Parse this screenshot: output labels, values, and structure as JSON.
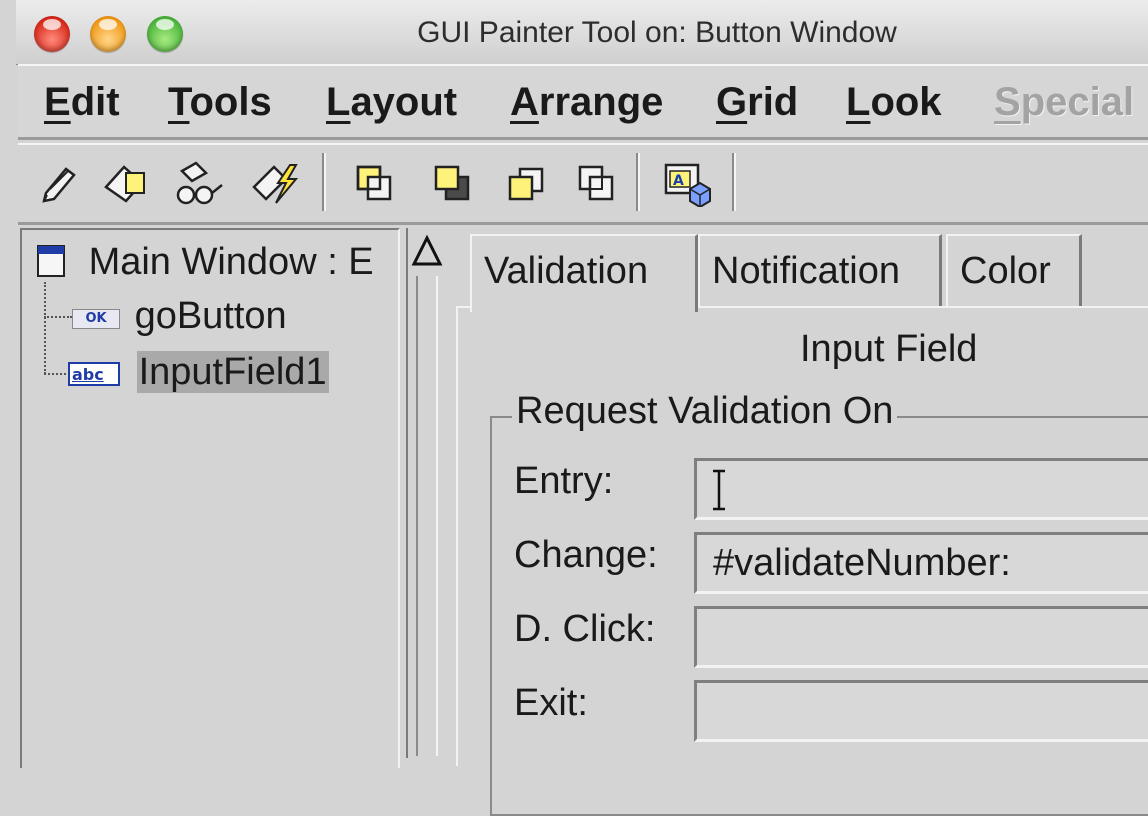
{
  "window": {
    "title": "GUI Painter Tool on: Button Window"
  },
  "menu": {
    "items": [
      {
        "first": "E",
        "rest": "dit"
      },
      {
        "first": "T",
        "rest": "ools"
      },
      {
        "first": "L",
        "rest": "ayout"
      },
      {
        "first": "A",
        "rest": "rrange"
      },
      {
        "first": "G",
        "rest": "rid"
      },
      {
        "first": "L",
        "rest": "ook"
      },
      {
        "first": "S",
        "rest": "pecial"
      }
    ]
  },
  "toolbar": {
    "icons": [
      "edit-pencil-icon",
      "paste-shape-icon",
      "inspect-glasses-icon",
      "install-lightning-icon",
      "bring-to-front-icon",
      "send-to-back-icon",
      "bring-forward-icon",
      "send-backward-icon",
      "resource-finder-icon"
    ]
  },
  "tree": {
    "root": "Main Window : E",
    "children": [
      {
        "badge": "OK",
        "label": "goButton"
      },
      {
        "badge": "abc",
        "label": "InputField1"
      }
    ]
  },
  "tabs": [
    "Validation",
    "Notification",
    "Color"
  ],
  "panel": {
    "title": "Input Field",
    "group_title": "Request Validation On",
    "fields": [
      {
        "label": "Entry:",
        "value": ""
      },
      {
        "label": "Change:",
        "value": "#validateNumber:"
      },
      {
        "label": "D. Click:",
        "value": ""
      },
      {
        "label": "Exit:",
        "value": ""
      }
    ]
  },
  "colors": {
    "selection": "#a9a9a9",
    "background": "#d4d4d4",
    "disabled_text": "#a3a3a3"
  }
}
